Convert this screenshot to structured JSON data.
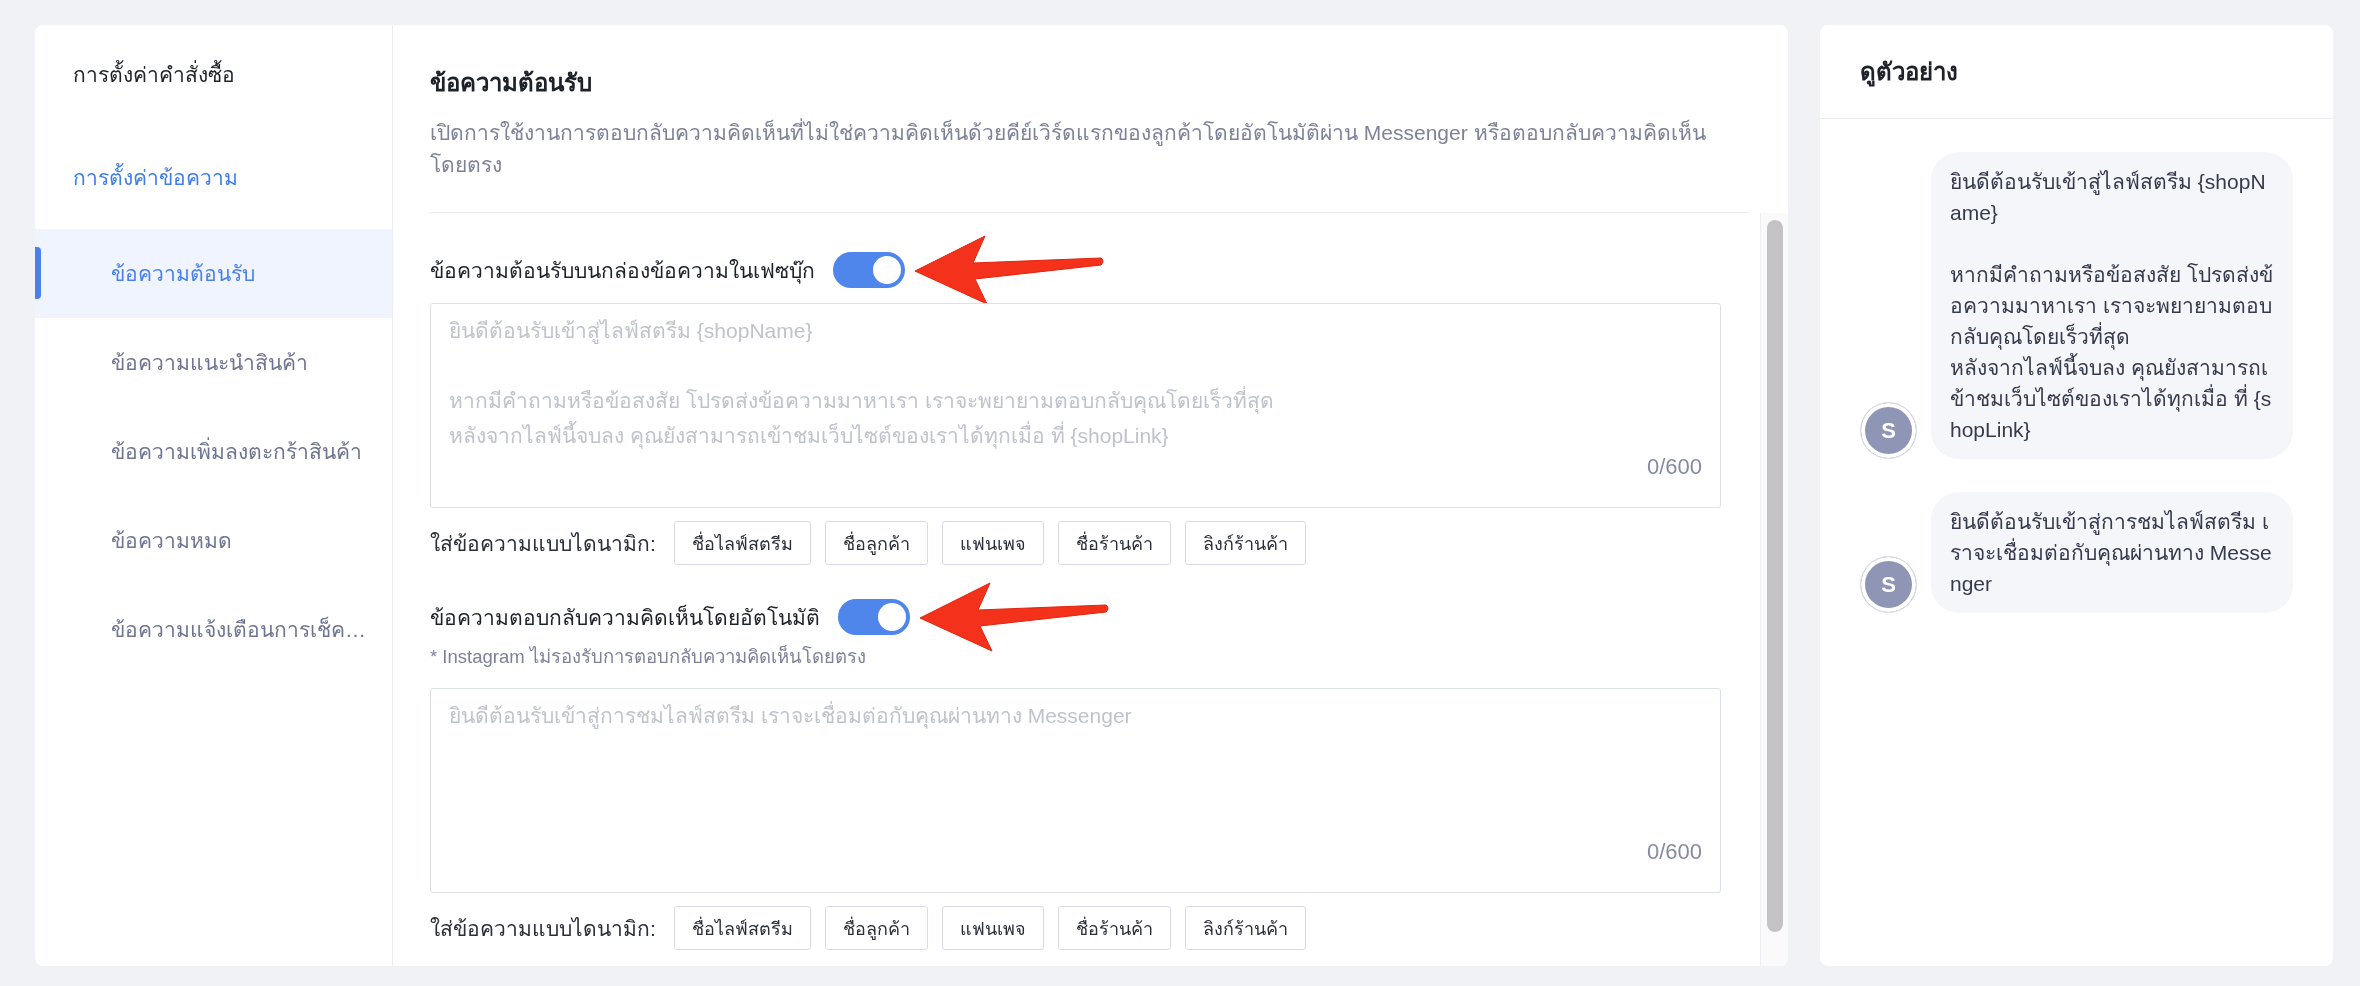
{
  "sidebar": {
    "items": [
      {
        "label": "การตั้งค่าคำสั่งซื้อ",
        "active": false
      },
      {
        "label": "การตั้งค่าข้อความ",
        "active": true,
        "children": [
          {
            "label": "ข้อความต้อนรับ",
            "selected": true
          },
          {
            "label": "ข้อความแนะนำสินค้า",
            "selected": false
          },
          {
            "label": "ข้อความเพิ่มลงตะกร้าสินค้า",
            "selected": false
          },
          {
            "label": "ข้อความหมด",
            "selected": false
          },
          {
            "label": "ข้อความแจ้งเตือนการเช็ค…",
            "selected": false
          }
        ]
      }
    ]
  },
  "header": {
    "title": "ข้อความต้อนรับ",
    "description": "เปิดการใช้งานการตอบกลับความคิดเห็นที่ไม่ใช่ความคิดเห็นด้วยคีย์เวิร์ดแรกของลูกค้าโดยอัตโนมัติผ่าน Messenger หรือตอบกลับความคิดเห็นโดยตรง"
  },
  "sections": [
    {
      "label": "ข้อความต้อนรับบนกล่องข้อความในเฟซบุ๊ก",
      "enabled": true,
      "annotated": true,
      "message": {
        "placeholder": "ยินดีต้อนรับเข้าสู่ไลฟ์สตรีม {shopName}\n\nหากมีคำถามหรือข้อสงสัย โปรดส่งข้อความมาหาเรา เราจะพยายามตอบกลับคุณโดยเร็วที่สุด\nหลังจากไลฟ์นี้จบลง คุณยังสามารถเข้าชมเว็บไซต์ของเราได้ทุกเมื่อ ที่ {shopLink}",
        "counter": "0/600"
      },
      "dynamic_label": "ใส่ข้อความแบบไดนามิก:",
      "dynamic_buttons": [
        "ชื่อไลฟ์สตรีม",
        "ชื่อลูกค้า",
        "แฟนเพจ",
        "ชื่อร้านค้า",
        "ลิงก์ร้านค้า"
      ]
    },
    {
      "label": "ข้อความตอบกลับความคิดเห็นโดยอัตโนมัติ",
      "enabled": true,
      "annotated": true,
      "note": "* Instagram ไม่รองรับการตอบกลับความคิดเห็นโดยตรง",
      "message": {
        "placeholder": "ยินดีต้อนรับเข้าสู่การชมไลฟ์สตรีม เราจะเชื่อมต่อกับคุณผ่านทาง Messenger",
        "counter": "0/600"
      },
      "dynamic_label": "ใส่ข้อความแบบไดนามิก:",
      "dynamic_buttons": [
        "ชื่อไลฟ์สตรีม",
        "ชื่อลูกค้า",
        "แฟนเพจ",
        "ชื่อร้านค้า",
        "ลิงก์ร้านค้า"
      ]
    }
  ],
  "preview": {
    "title": "ดูตัวอย่าง",
    "messages": [
      {
        "avatar": "S",
        "text": "ยินดีต้อนรับเข้าสู่ไลฟ์สตรีม {shopName}\n\nหากมีคำถามหรือข้อสงสัย โปรดส่งข้อความมาหาเรา เราจะพยายามตอบกลับคุณโดยเร็วที่สุด\nหลังจากไลฟ์นี้จบลง คุณยังสามารถเข้าชมเว็บไซต์ของเราได้ทุกเมื่อ ที่ {shopLink}"
      },
      {
        "avatar": "S",
        "text": "ยินดีต้อนรับเข้าสู่การชมไลฟ์สตรีม เราจะเชื่อมต่อกับคุณผ่านทาง Messenger"
      }
    ]
  }
}
